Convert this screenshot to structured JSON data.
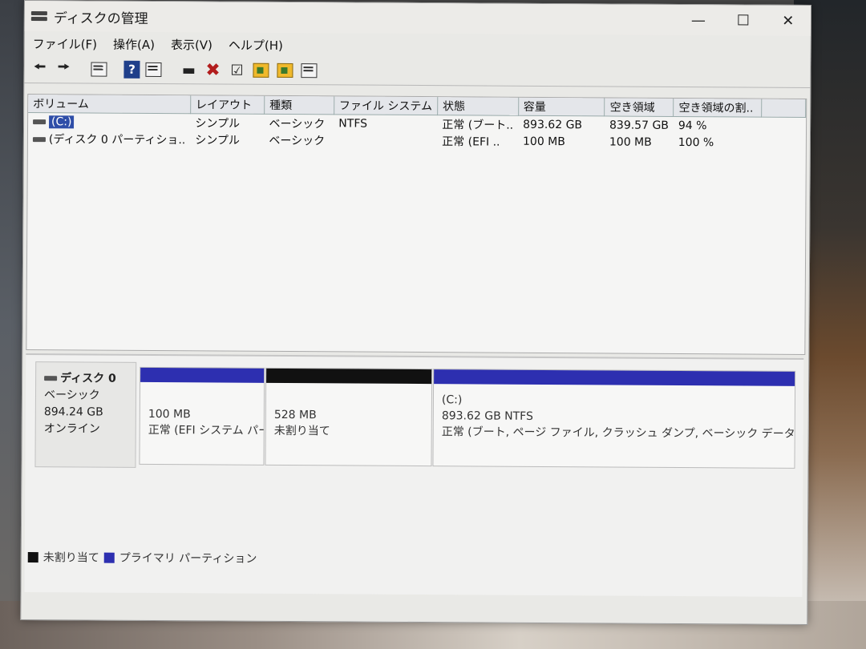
{
  "window": {
    "title": "ディスクの管理"
  },
  "menu": [
    "ファイル(F)",
    "操作(A)",
    "表示(V)",
    "ヘルプ(H)"
  ],
  "toolbar": [
    "back-icon",
    "forward-icon",
    "properties-icon",
    "help-icon",
    "view-icon",
    "connect-icon",
    "delete-icon",
    "check-icon",
    "import-icon",
    "search-icon",
    "list-icon"
  ],
  "volume_table": {
    "headers": [
      "ボリューム",
      "レイアウト",
      "種類",
      "ファイル システム",
      "状態",
      "容量",
      "空き領域",
      "空き領域の割.."
    ],
    "rows": [
      [
        "(C:)",
        "シンプル",
        "ベーシック",
        "NTFS",
        "正常 (ブート..",
        "893.62 GB",
        "839.57 GB",
        "94 %"
      ],
      [
        "(ディスク 0 パーティショ..",
        "シンプル",
        "ベーシック",
        "",
        "正常 (EFI ..",
        "100 MB",
        "100 MB",
        "100 %"
      ]
    ]
  },
  "disk": {
    "name": "ディスク 0",
    "type": "ベーシック",
    "size": "894.24 GB",
    "status": "オンライン",
    "partitions": [
      {
        "title": "",
        "size": "100 MB",
        "status": "正常 (EFI システム パー",
        "color": "#2d2fb0"
      },
      {
        "title": "",
        "size": "528 MB",
        "status": "未割り当て",
        "color": "#111111"
      },
      {
        "title": "(C:)",
        "size": "893.62 GB NTFS",
        "status": "正常 (ブート, ページ ファイル, クラッシュ ダンプ, ベーシック データ パーティション)",
        "color": "#2d2fb0"
      }
    ]
  },
  "legend": [
    {
      "label": "未割り当て",
      "color": "#111111"
    },
    {
      "label": "プライマリ パーティション",
      "color": "#2d2fb0"
    }
  ],
  "colors": {
    "primary": "#2d2fb0",
    "unallocated": "#111111",
    "selection": "#2f4ea8"
  }
}
